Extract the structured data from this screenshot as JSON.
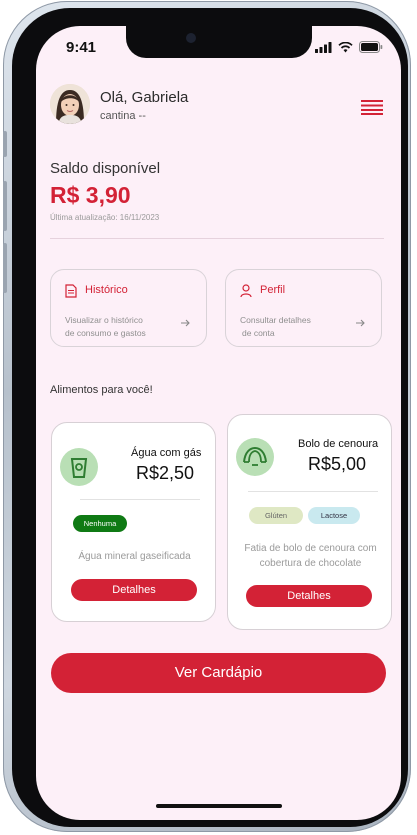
{
  "status_bar": {
    "time": "9:41",
    "icons": [
      "signal-icon",
      "wifi-icon",
      "battery-icon"
    ]
  },
  "header": {
    "greeting": "Olá, Gabriela",
    "subtitle": "cantina --",
    "avatar": "avatar-photo",
    "menu_icon": "hamburger-menu-icon"
  },
  "balance": {
    "label": "Saldo disponível",
    "value": "R$ 3,90",
    "updated": "Última atualização: 16/11/2023"
  },
  "quick_links": [
    {
      "title": "Histórico",
      "description_line1": "Visualizar o histórico",
      "description_line2": "de consumo e gastos",
      "icon": "document-icon",
      "arrow": "arrow-right-icon"
    },
    {
      "title": "Perfil",
      "description_line1": "Consultar detalhes",
      "description_line2": "de conta",
      "icon": "user-icon",
      "arrow": "arrow-right-icon"
    }
  ],
  "foods_section": {
    "title": "Alimentos para você!"
  },
  "foods": [
    {
      "name": "Água com gás",
      "price": "R$2,50",
      "tags": [
        {
          "label": "Nenhuma",
          "color": "#0f7a14"
        }
      ],
      "description_line1": "Água mineral gaseificada",
      "description_line2": "",
      "button": "Detalhes",
      "icon": "cup-icon"
    },
    {
      "name": "Bolo de cenoura",
      "price": "R$5,00",
      "tags": [
        {
          "label": "Glúten",
          "color": "#dfe8c4"
        },
        {
          "label": "Lactose",
          "color": "#c9e9ef"
        }
      ],
      "description_line1": "Fatia de bolo de cenoura com",
      "description_line2": "cobertura de chocolate",
      "button": "Detalhes",
      "icon": "croissant-icon"
    }
  ],
  "cta": {
    "label": "Ver Cardápio"
  },
  "colors": {
    "accent": "#d32236",
    "background": "#fdf0f8",
    "icon_circle": "#b9dfb5"
  }
}
